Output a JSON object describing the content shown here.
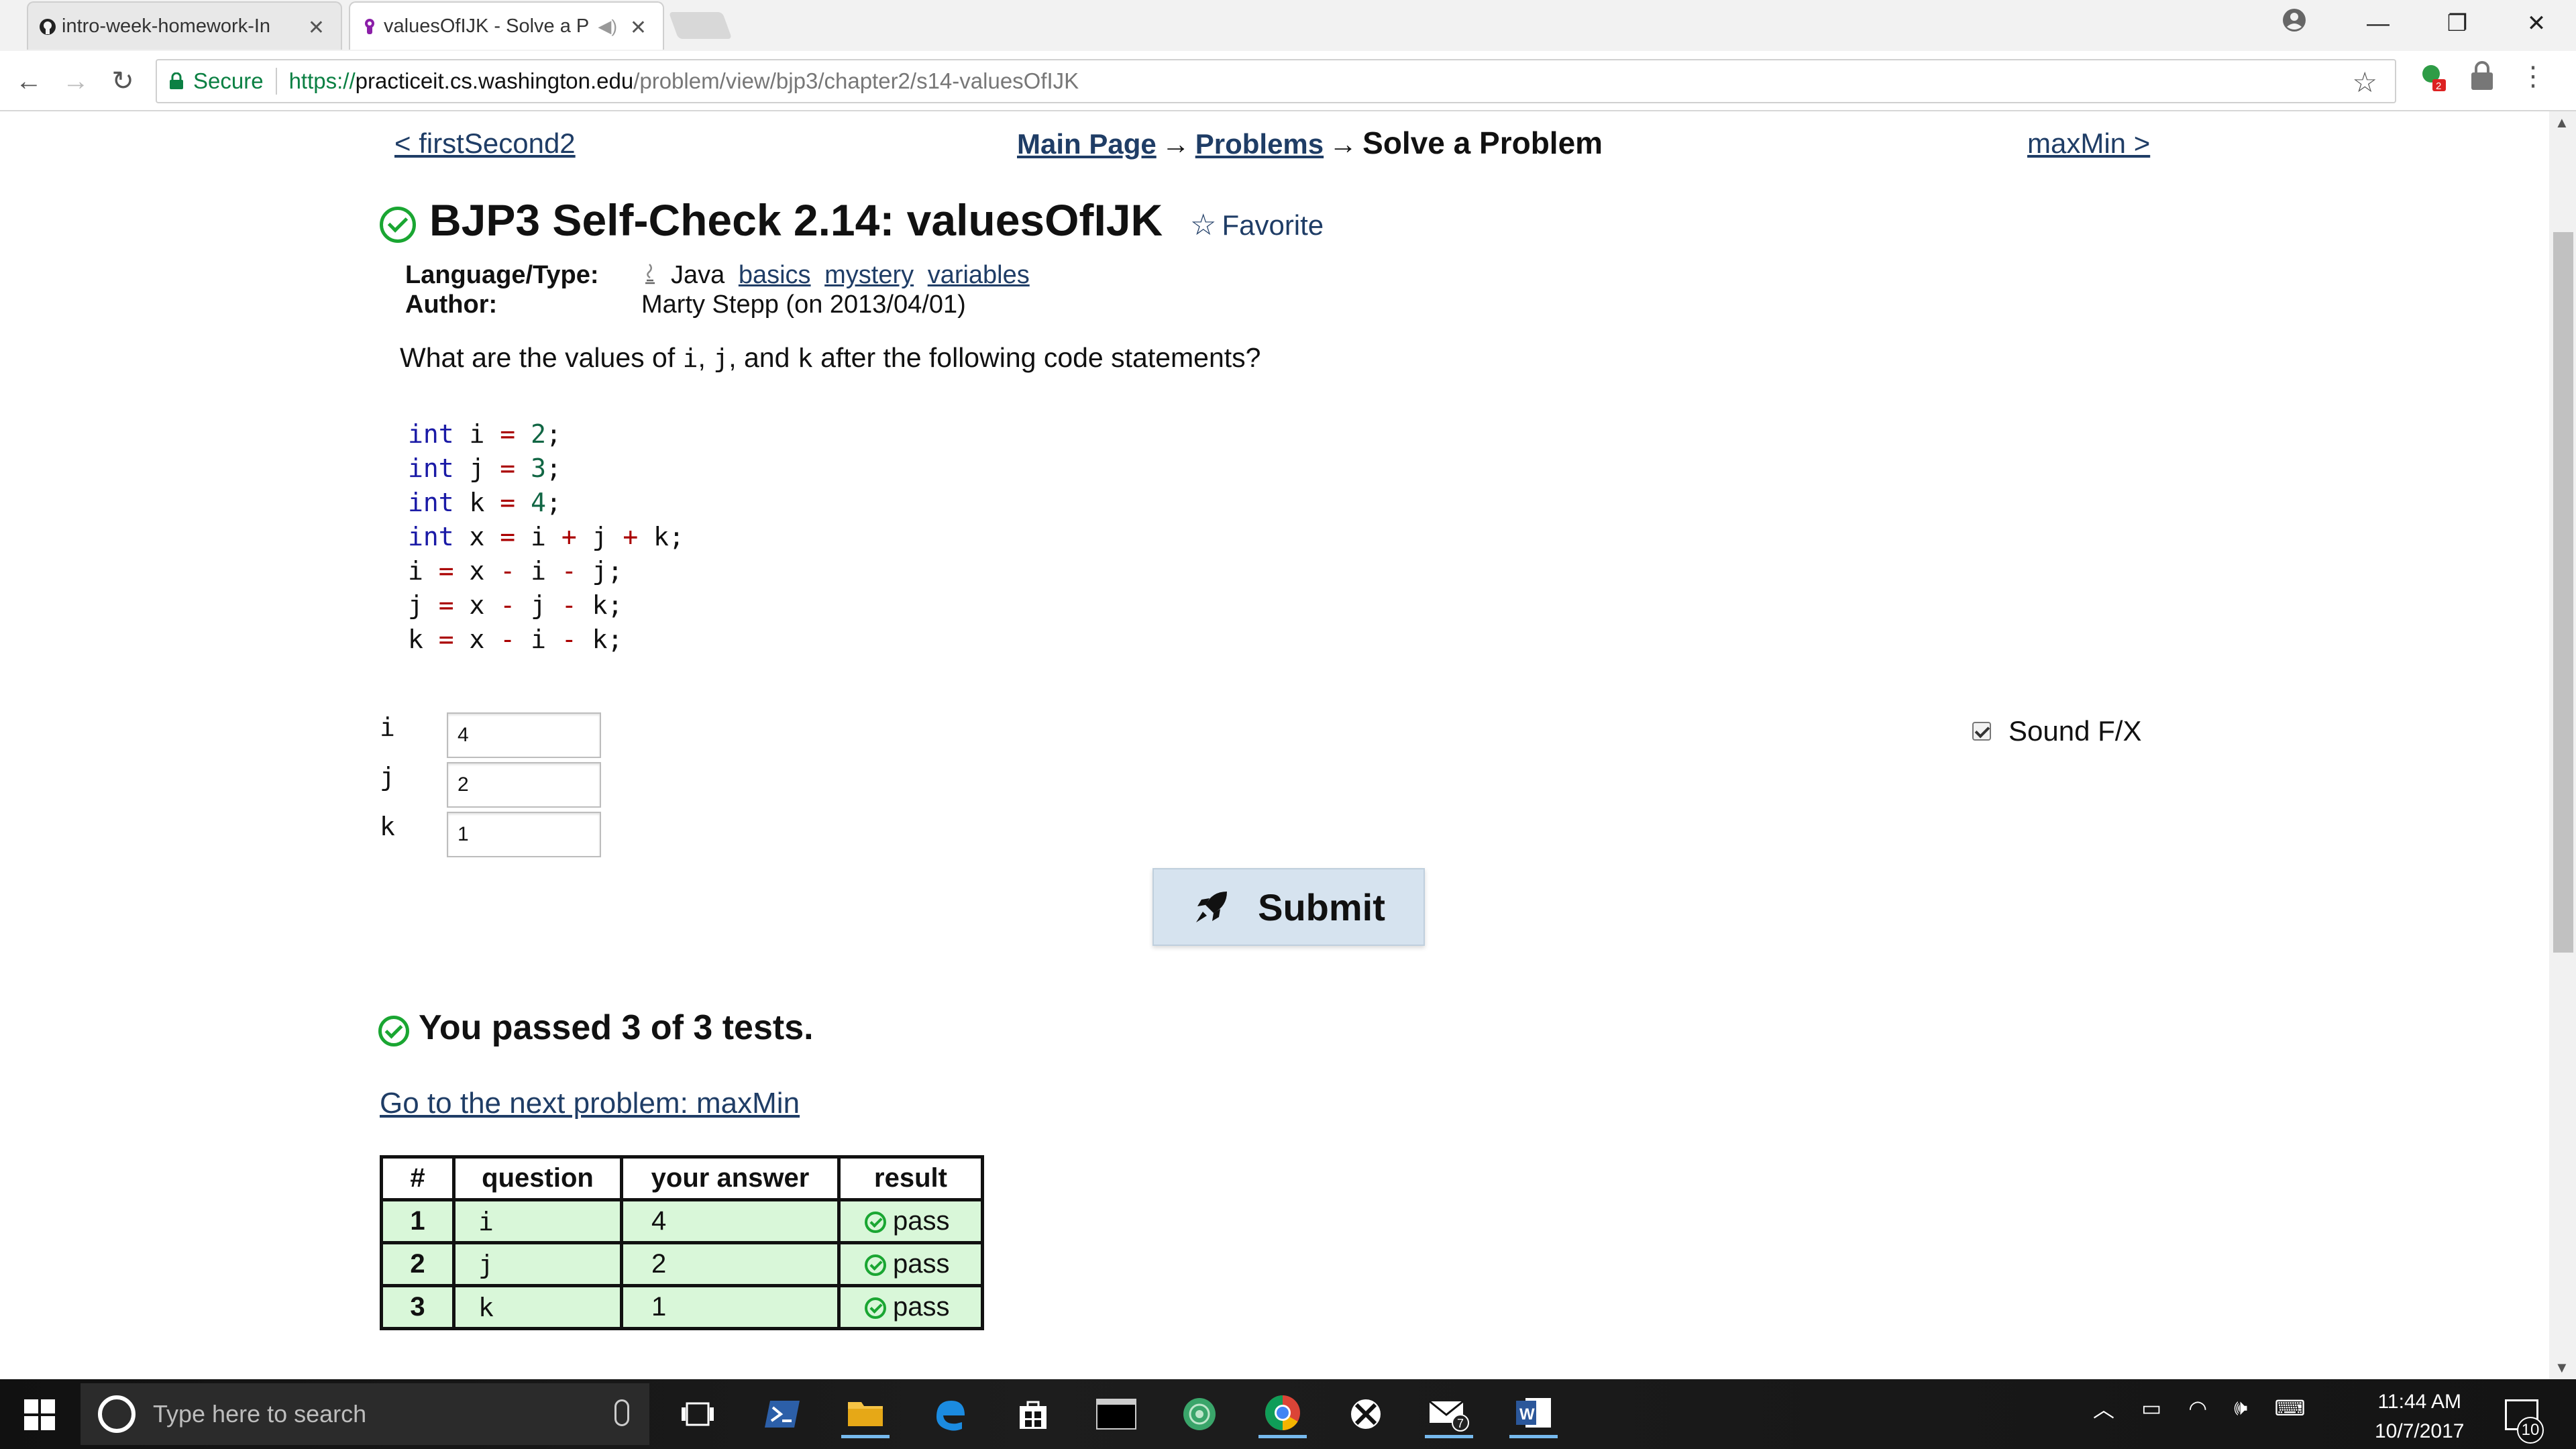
{
  "browser": {
    "tabs": [
      {
        "title": "intro-week-homework-In",
        "icon": "github-icon"
      },
      {
        "title": "valuesOfIJK - Solve a P",
        "icon": "practiceit-icon"
      }
    ],
    "secure_label": "Secure",
    "url": {
      "scheme": "https://",
      "host": "practiceit.cs.washington.edu",
      "path": "/problem/view/bjp3/chapter2/s14-valuesOfIJK"
    },
    "extension_badge": "2",
    "window_controls": {
      "minimize": "—",
      "restore": "❐",
      "close": "✕"
    }
  },
  "nav": {
    "prev": "< firstSecond2",
    "next": "maxMin >",
    "breadcrumb": {
      "main_page": "Main Page",
      "arrow": "→",
      "problems": "Problems",
      "current": "Solve a Problem"
    }
  },
  "problem": {
    "title": "BJP3 Self-Check 2.14: valuesOfIJK",
    "favorite": "Favorite",
    "language_label": "Language/Type:",
    "language": "Java",
    "tags": [
      "basics",
      "mystery",
      "variables"
    ],
    "author_label": "Author:",
    "author": "Marty Stepp (on 2013/04/01)",
    "question_parts": [
      "What are the values of ",
      "i",
      ", ",
      "j",
      ", and ",
      "k",
      " after the following code statements?"
    ]
  },
  "answers": [
    {
      "label": "i",
      "value": "4"
    },
    {
      "label": "j",
      "value": "2"
    },
    {
      "label": "k",
      "value": "1"
    }
  ],
  "sound_label": "Sound F/X",
  "sound_checked": true,
  "submit_label": "Submit",
  "result": {
    "message": "You passed 3 of 3 tests.",
    "next_link": "Go to the next problem: maxMin",
    "headers": [
      "#",
      "question",
      "your answer",
      "result"
    ],
    "rows": [
      {
        "num": "1",
        "question": "i",
        "answer": "4",
        "result": "pass"
      },
      {
        "num": "2",
        "question": "j",
        "answer": "2",
        "result": "pass"
      },
      {
        "num": "3",
        "question": "k",
        "answer": "1",
        "result": "pass"
      }
    ]
  },
  "taskbar": {
    "search_placeholder": "Type here to search",
    "time": "11:44 AM",
    "date": "10/7/2017",
    "mail_badge": "7",
    "notification_count": "10"
  },
  "colors": {
    "pass": "#1aa632",
    "link": "#1f3d66",
    "row_pass_bg": "#d9f7d9",
    "secure": "#0b8043"
  }
}
